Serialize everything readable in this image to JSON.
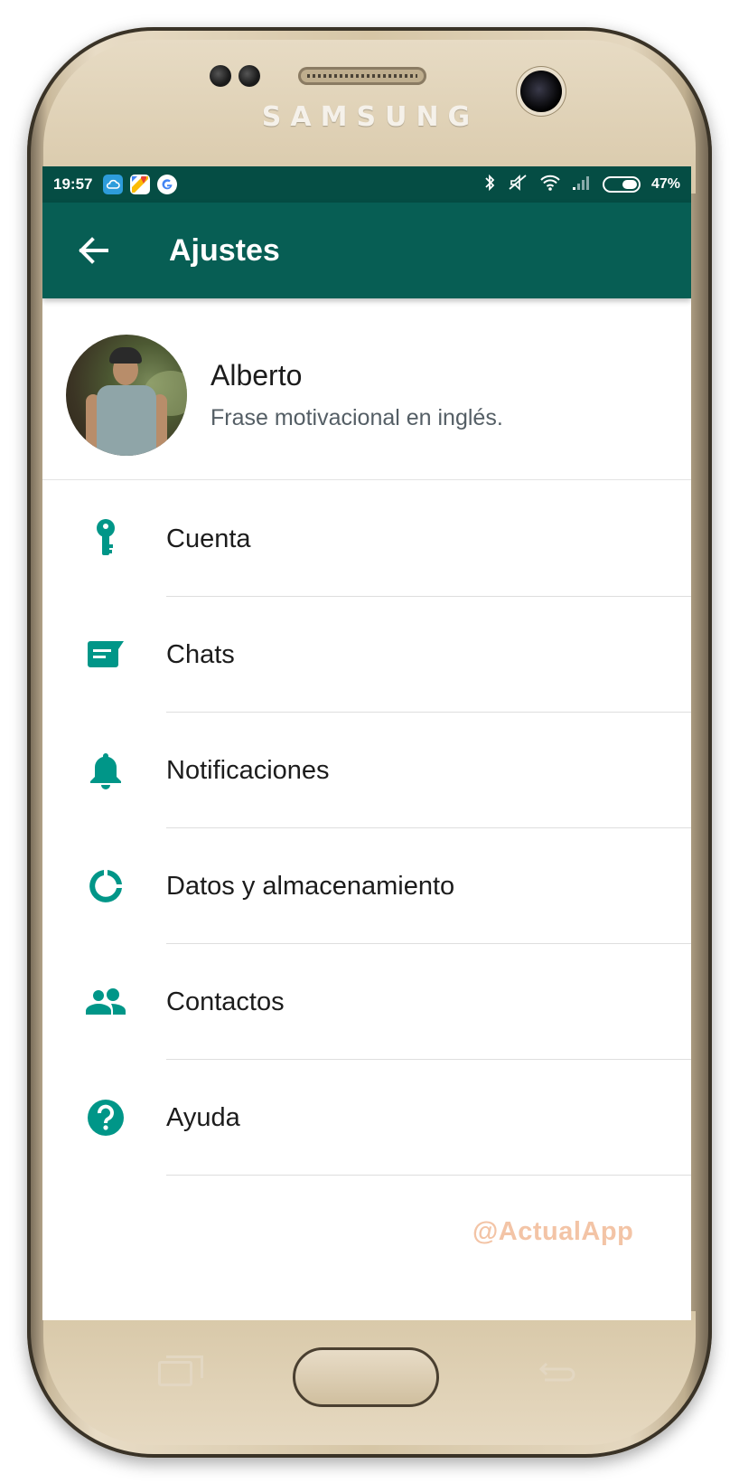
{
  "device": {
    "brand": "SAMSUNG"
  },
  "status_bar": {
    "time": "19:57",
    "left_icons": [
      "cloud-icon",
      "maps-icon",
      "google-icon"
    ],
    "right_icons": [
      "bluetooth-icon",
      "mute-icon",
      "wifi-icon",
      "signal-icon",
      "battery-icon"
    ],
    "battery_percent": "47%"
  },
  "app_bar": {
    "back_icon": "arrow-left-icon",
    "title": "Ajustes"
  },
  "profile": {
    "name": "Alberto",
    "status": "Frase motivacional en inglés."
  },
  "settings": [
    {
      "label": "Cuenta",
      "icon": "key-icon"
    },
    {
      "label": "Chats",
      "icon": "chat-icon"
    },
    {
      "label": "Notificaciones",
      "icon": "bell-icon"
    },
    {
      "label": "Datos y almacenamiento",
      "icon": "data-usage-icon"
    },
    {
      "label": "Contactos",
      "icon": "contacts-icon"
    },
    {
      "label": "Ayuda",
      "icon": "help-icon"
    }
  ],
  "watermark": "@ActualApp",
  "colors": {
    "status_bar": "#054d44",
    "app_bar": "#075e54",
    "accent_teal": "#009688",
    "watermark": "#f3c4a6"
  }
}
